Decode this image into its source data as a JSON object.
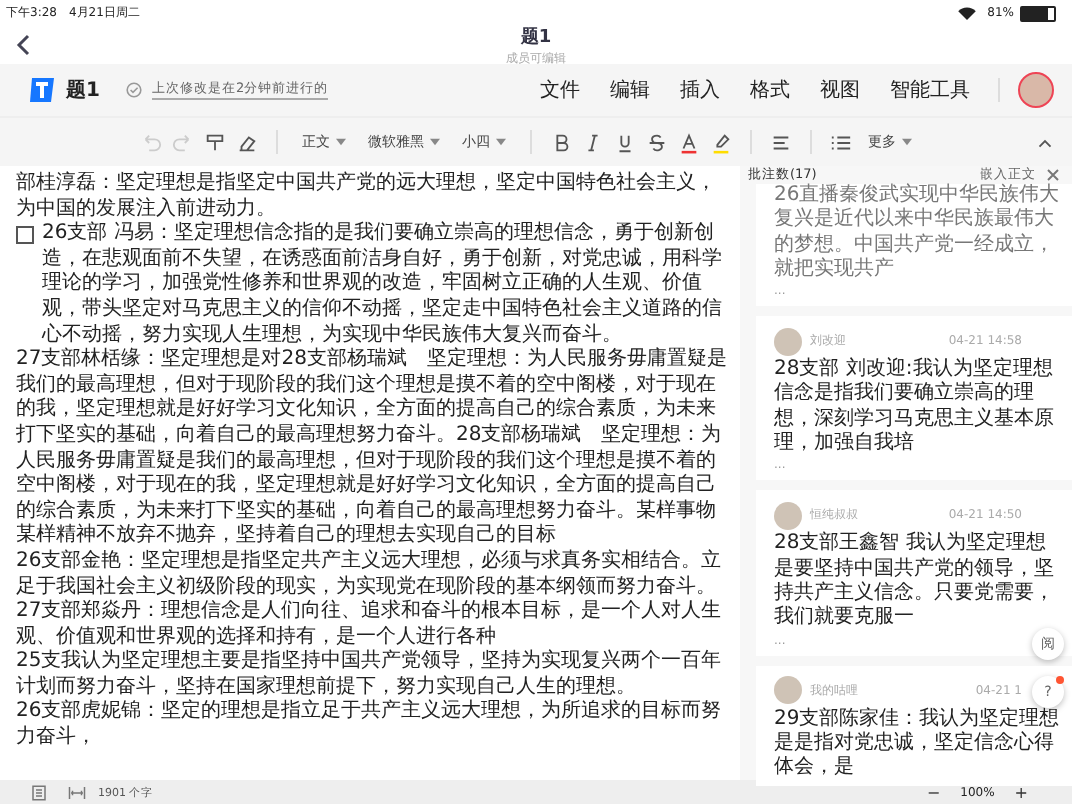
{
  "status_bar": {
    "time": "下午3:28",
    "date": "4月21日周二",
    "battery_text": "81%",
    "battery": {
      "level": 0.81
    }
  },
  "title_bar": {
    "title": "题1",
    "subtitle": "成员可编辑"
  },
  "header": {
    "doc_name": "题1",
    "save_status": "上次修改是在2分钟前进行的",
    "menus": [
      "文件",
      "编辑",
      "插入",
      "格式",
      "视图",
      "智能工具"
    ]
  },
  "toolbar": {
    "style": "正文",
    "font": "微软雅黑",
    "size": "小四",
    "more": "更多"
  },
  "document": {
    "paragraphs": [
      {
        "kind": "text",
        "text": "部桂淳磊：坚定理想是指坚定中国共产党的远大理想，坚定中国特色社会主义，为中国的发展注入前进动力。"
      },
      {
        "kind": "todo",
        "checked": false,
        "text": "26支部 冯易：坚定理想信念指的是我们要确立崇高的理想信念，勇于创新创造，在悲观面前不失望，在诱惑面前洁身自好，勇于创新，对党忠诚，用科学理论的学习，加强党性修养和世界观的改造，牢固树立正确的人生观、价值观，带头坚定对马克思主义的信仰不动摇，坚定走中国特色社会主义道路的信心不动摇，努力实现人生理想，为实现中华民族伟大复兴而奋斗。"
      },
      {
        "kind": "text",
        "text": "27支部林栝缘：坚定理想是对28支部杨瑞斌　坚定理想：为人民服务毋庸置疑是我们的最高理想，但对于现阶段的我们这个理想是摸不着的空中阁楼，对于现在的我，坚定理想就是好好学习文化知识，全方面的提高自己的综合素质，为未来打下坚实的基础，向着自己的最高理想努力奋斗。28支部杨瑞斌　坚定理想：为人民服务毋庸置疑是我们的最高理想，但对于现阶段的我们这个理想是摸不着的空中阁楼，对于现在的我，坚定理想就是好好学习文化知识，全方面的提高自己的综合素质，为未来打下坚实的基础，向着自己的最高理想努力奋斗。某样事物某样精神不放弃不抛弃，坚持着自己的理想去实现自己的目标"
      },
      {
        "kind": "text",
        "text": "26支部金艳：坚定理想是指坚定共产主义远大理想，必须与求真务实相结合。立足于我国社会主义初级阶段的现实，为实现党在现阶段的基本纲领而努力奋斗。"
      },
      {
        "kind": "text",
        "text": "27支部郑焱丹：理想信念是人们向往、追求和奋斗的根本目标，是一个人对人生观、价值观和世界观的选择和持有，是一个人进行各种"
      },
      {
        "kind": "text",
        "text": "25支我认为坚定理想主要是指坚持中国共产党领导，坚持为实现复兴两个一百年计划而努力奋斗，坚持在国家理想前提下，努力实现自己人生的理想。"
      },
      {
        "kind": "text",
        "text": "26支部虎妮锦：坚定的理想是指立足于共产主义远大理想，为所追求的目标而努力奋斗，"
      }
    ]
  },
  "comments": {
    "title": "批注数(17)",
    "insert_label": "嵌入正文",
    "items": [
      {
        "kind": "partial",
        "text": "26直播秦俊武实现中华民族伟大复兴是近代以来中华民族最伟大的梦想。中国共产党一经成立，就把实现共产",
        "more": "..."
      },
      {
        "kind": "full",
        "author": "刘改迎",
        "time": "04-21 14:58",
        "text": "28支部 刘改迎:我认为坚定理想信念是指我们要确立崇高的理想，深刻学习马克思主义基本原理，加强自我培",
        "more": "..."
      },
      {
        "kind": "full",
        "author": "恒纯叔叔",
        "time": "04-21 14:50",
        "text": "28支部王鑫智 我认为坚定理想是要坚持中国共产党的领导，坚持共产主义信念。只要党需要，我们就要克服一",
        "more": "..."
      },
      {
        "kind": "full",
        "author": "我的咕哩",
        "time": "04-21 1",
        "text": "29支部陈家佳：我认为坚定理想是是指对党忠诚，坚定信念心得体会，是"
      }
    ]
  },
  "floating": {
    "read_label": "阅",
    "help_label": "?",
    "help_badge": true
  },
  "footer": {
    "word_count": "1901 个字",
    "zoom_out": "−",
    "zoom": "100%",
    "zoom_in": "+"
  }
}
